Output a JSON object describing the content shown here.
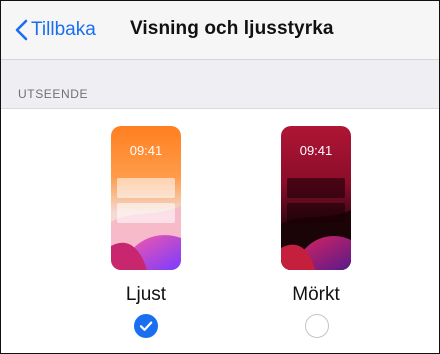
{
  "nav": {
    "back_label": "Tillbaka",
    "title": "Visning och ljusstyrka"
  },
  "section": {
    "header": "UTSEENDE"
  },
  "appearance": {
    "options": [
      {
        "label": "Ljust",
        "preview_time": "09:41",
        "selected": true
      },
      {
        "label": "Mörkt",
        "preview_time": "09:41",
        "selected": false
      }
    ]
  },
  "colors": {
    "accent": "#1a6ff0",
    "nav_background": "#f6f6f7",
    "section_background": "#efeff3"
  },
  "icons": {
    "back": "chevron-left-icon",
    "selected": "checkmark-icon",
    "unselected": "empty-circle-icon"
  }
}
